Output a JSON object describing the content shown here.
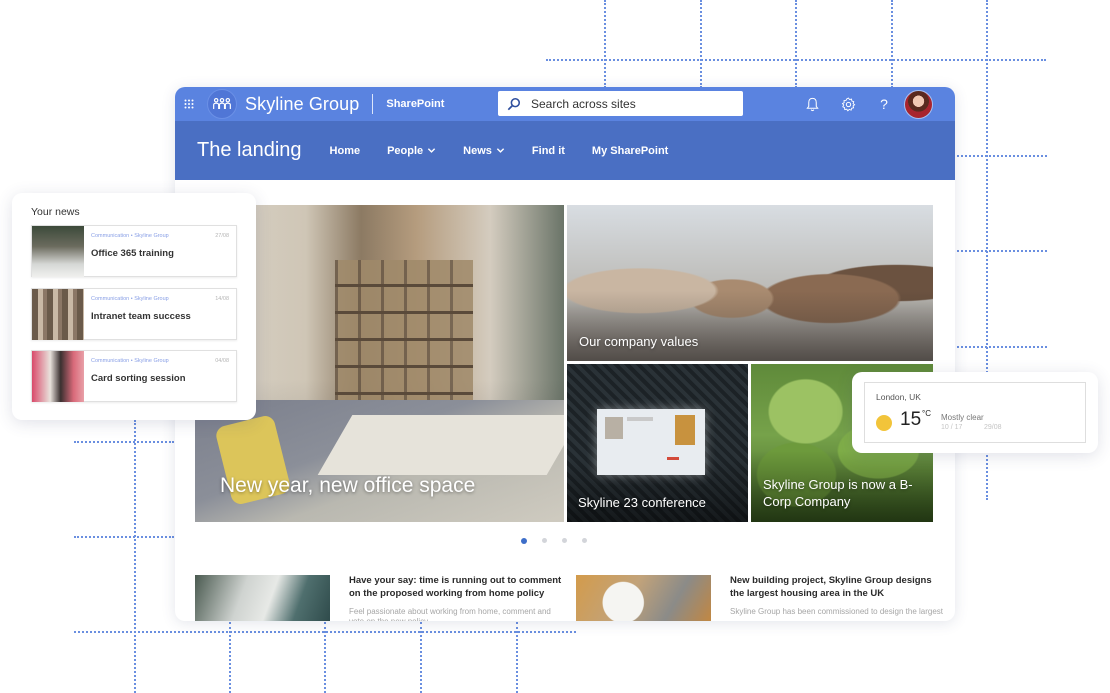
{
  "suitebar": {
    "brand": "Skyline Group",
    "app": "SharePoint",
    "search_placeholder": "Search across sites",
    "icons": [
      "app-launcher-icon",
      "team-logo-icon",
      "search-icon",
      "bell-icon",
      "gear-icon",
      "help-icon",
      "avatar"
    ],
    "help_glyph": "?"
  },
  "hub": {
    "site_title": "The landing",
    "nav": [
      {
        "label": "Home",
        "has_dropdown": false
      },
      {
        "label": "People",
        "has_dropdown": true
      },
      {
        "label": "News",
        "has_dropdown": true
      },
      {
        "label": "Find it",
        "has_dropdown": false
      },
      {
        "label": "My SharePoint",
        "has_dropdown": false
      }
    ]
  },
  "hero": {
    "tiles": [
      {
        "caption": "New year, new office space"
      },
      {
        "caption": "Our company values"
      },
      {
        "caption": "Skyline 23 conference"
      },
      {
        "caption": "Skyline Group is now a B-Corp Company"
      }
    ],
    "carousel": {
      "pages": 4,
      "active": 1
    }
  },
  "news": [
    {
      "headline": "Have your say: time is running out to comment on the proposed working from home policy",
      "excerpt": "Feel passionate about working from home, comment and vote on the new policy"
    },
    {
      "headline": "New building project, Skyline Group designs the largest housing area in the UK",
      "excerpt": "Skyline Group has been commissioned to design the largest"
    }
  ],
  "your_news": {
    "title": "Your news",
    "items": [
      {
        "meta": "Communication • Skyline Group",
        "date": "27/08",
        "title": "Office 365 training"
      },
      {
        "meta": "Communication • Skyline Group",
        "date": "14/08",
        "title": "Intranet team success"
      },
      {
        "meta": "Communication • Skyline Group",
        "date": "04/08",
        "title": "Card sorting session"
      }
    ]
  },
  "weather": {
    "location": "London, UK",
    "temperature": "15",
    "unit": "°C",
    "condition": "Mostly clear",
    "range": "10 / 17",
    "date": "29/08",
    "sun_color": "#f2c43a"
  },
  "colors": {
    "suitebar": "#5a83e0",
    "hubbar": "#4a6fc3",
    "accent": "#3d6ec9",
    "grid_dots": "#6a8fe0"
  }
}
